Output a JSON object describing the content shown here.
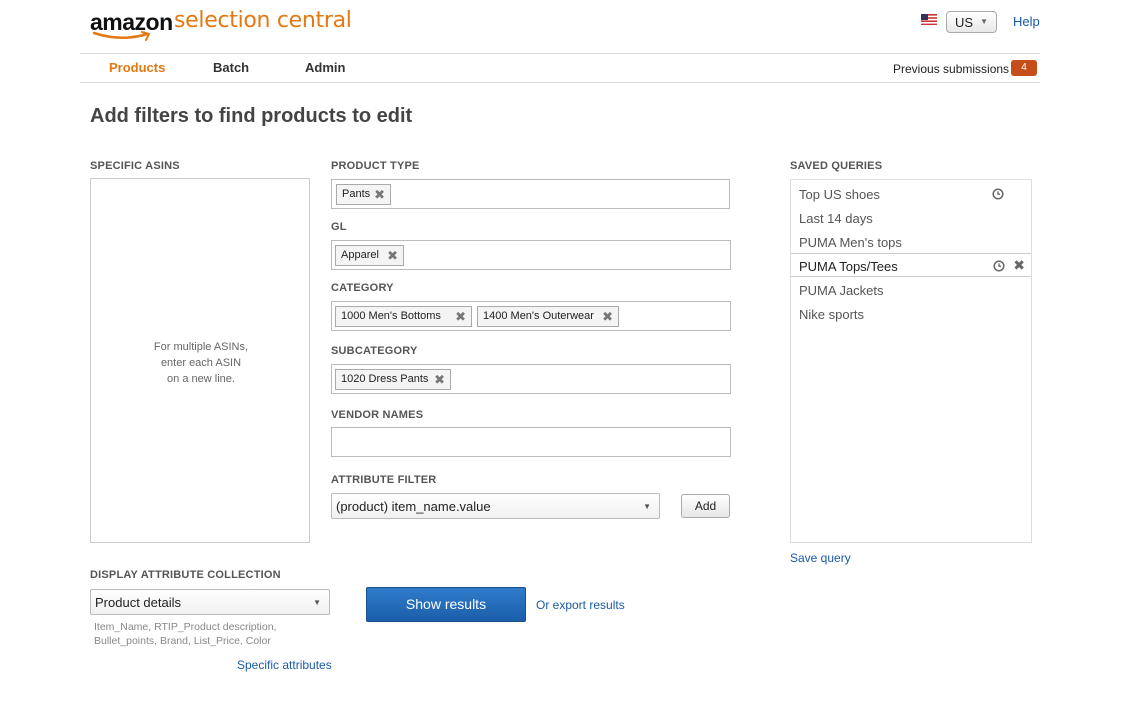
{
  "brand": {
    "amazon": "amazon",
    "product": "selection central"
  },
  "header": {
    "flag_icon": "us-flag-icon",
    "country": "US",
    "help": "Help"
  },
  "nav": {
    "tabs": [
      {
        "label": "Products",
        "active": true
      },
      {
        "label": "Batch",
        "active": false
      },
      {
        "label": "Admin",
        "active": false
      }
    ],
    "previous_submissions": "Previous submissions",
    "previous_submissions_count": "4"
  },
  "page_title": "Add filters to find products to edit",
  "specific_asins": {
    "label": "SPECIFIC ASINS",
    "hint_lines": [
      "For multiple ASINs,",
      "enter each ASIN",
      "on  a new line."
    ]
  },
  "filters": {
    "product_type": {
      "label": "PRODUCT TYPE",
      "tokens": [
        "Pants"
      ]
    },
    "gl": {
      "label": "GL",
      "tokens": [
        "Apparel"
      ]
    },
    "category": {
      "label": "CATEGORY",
      "tokens": [
        "1000 Men's Bottoms",
        "1400 Men's Outerwear"
      ]
    },
    "subcategory": {
      "label": "SUBCATEGORY",
      "tokens": [
        "1020 Dress Pants"
      ]
    },
    "vendor_names": {
      "label": "VENDOR NAMES",
      "value": ""
    },
    "attribute_filter": {
      "label": "ATTRIBUTE FILTER",
      "selected": "(product) item_name.value",
      "add_label": "Add"
    }
  },
  "saved_queries": {
    "label": "SAVED QUERIES",
    "items": [
      {
        "name": "Top US shoes",
        "scheduled": true,
        "selected": false
      },
      {
        "name": "Last 14 days",
        "scheduled": false,
        "selected": false
      },
      {
        "name": "PUMA Men's tops",
        "scheduled": false,
        "selected": false
      },
      {
        "name": "PUMA Tops/Tees",
        "scheduled": true,
        "selected": true
      },
      {
        "name": "PUMA Jackets",
        "scheduled": false,
        "selected": false
      },
      {
        "name": "Nike sports",
        "scheduled": false,
        "selected": false
      }
    ],
    "save_query": "Save query"
  },
  "display": {
    "label": "DISPLAY ATTRIBUTE COLLECTION",
    "selected": "Product details",
    "description_lines": [
      "Item_Name, RTIP_Product description,",
      "Bullet_points, Brand, List_Price, Color"
    ],
    "specific_attributes": "Specific attributes"
  },
  "actions": {
    "show_results": "Show results",
    "export": "Or export results"
  },
  "colors": {
    "brand_orange": "#e47911",
    "link_blue": "#1a5aa6",
    "primary_button": "#2f7ccb",
    "badge": "#c44d18"
  }
}
